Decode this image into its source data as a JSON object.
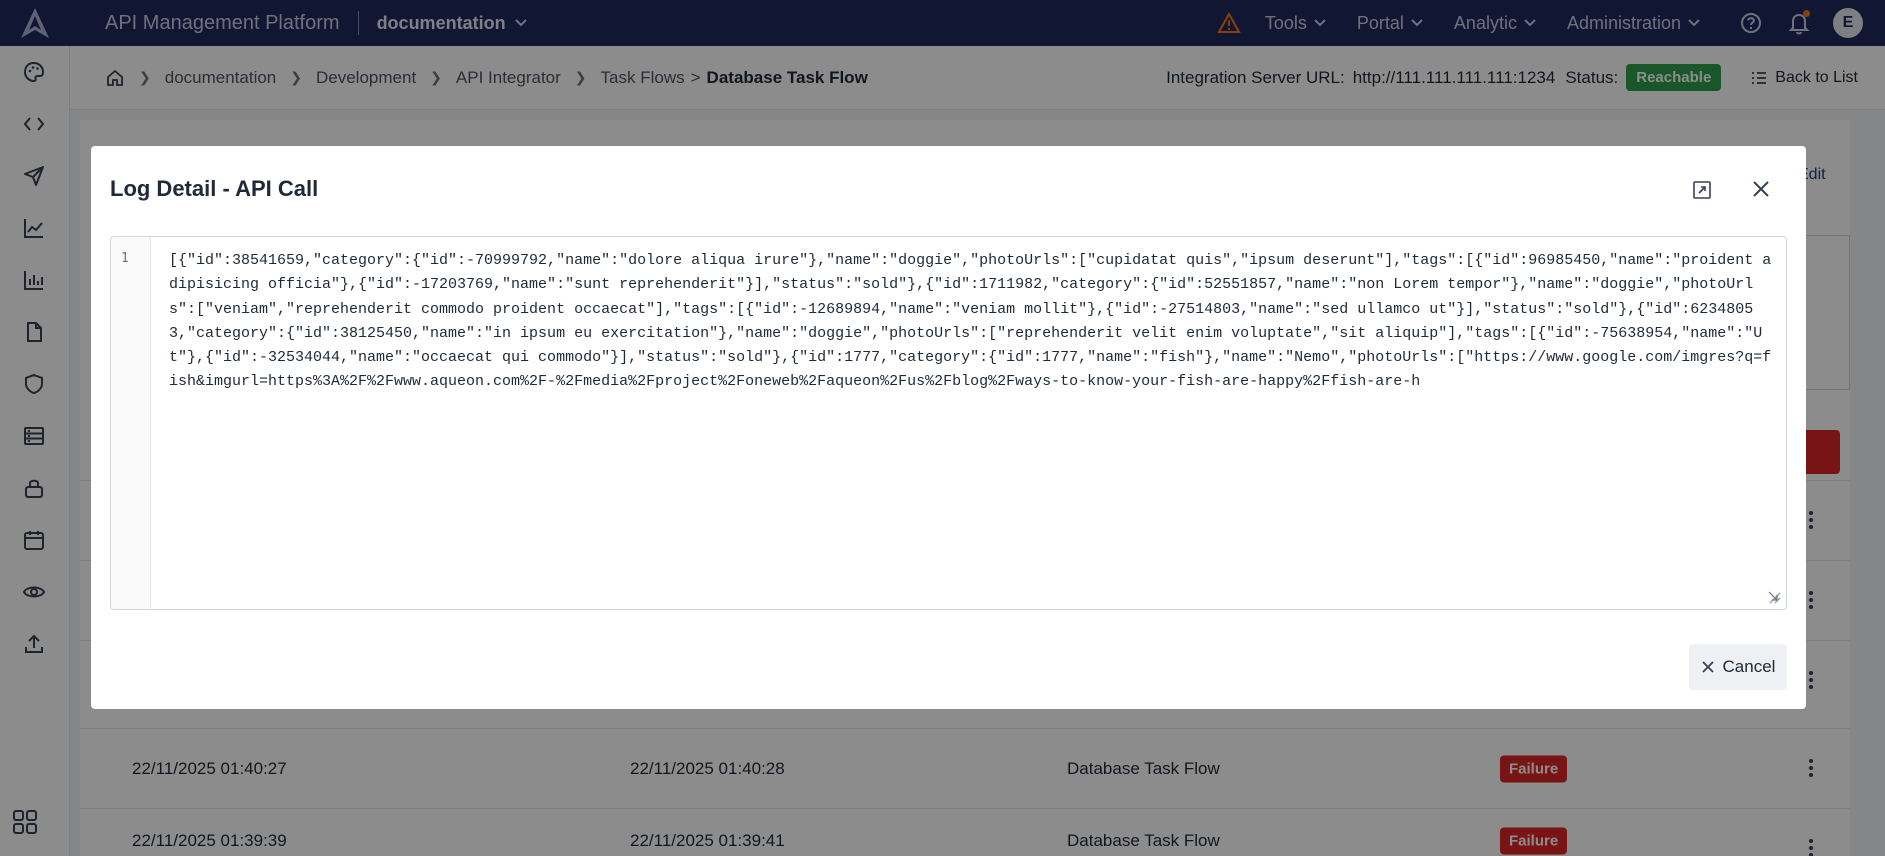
{
  "topbar": {
    "app_title": "API Management Platform",
    "workspace": "documentation",
    "nav": [
      "Tools",
      "Portal",
      "Analytic",
      "Administration"
    ],
    "avatar_initial": "E"
  },
  "breadcrumb": {
    "items": [
      "documentation",
      "Development",
      "API Integrator"
    ],
    "tail_link": "Task Flows",
    "tail_sep": ">",
    "current": "Database Task Flow"
  },
  "server": {
    "label": "Integration Server URL:",
    "url": "http://111.111.111.111:1234",
    "status_label": "Status:",
    "status_value": "Reachable",
    "back_label": "Back to List"
  },
  "content": {
    "edit_label": "Edit",
    "rows": [
      {
        "start": "22/11/2025 01:40:27",
        "end": "22/11/2025 01:40:28",
        "flow": "Database Task Flow",
        "status": "Failure"
      },
      {
        "start": "22/11/2025 01:39:39",
        "end": "22/11/2025 01:39:41",
        "flow": "Database Task Flow",
        "status": "Failure"
      }
    ]
  },
  "modal": {
    "title": "Log Detail - API Call",
    "line_number": "1",
    "code": "[{\"id\":38541659,\"category\":{\"id\":-70999792,\"name\":\"dolore aliqua irure\"},\"name\":\"doggie\",\"photoUrls\":[\"cupidatat quis\",\"ipsum deserunt\"],\"tags\":[{\"id\":96985450,\"name\":\"proident adipisicing officia\"},{\"id\":-17203769,\"name\":\"sunt reprehenderit\"}],\"status\":\"sold\"},{\"id\":1711982,\"category\":{\"id\":52551857,\"name\":\"non Lorem tempor\"},\"name\":\"doggie\",\"photoUrls\":[\"veniam\",\"reprehenderit commodo proident occaecat\"],\"tags\":[{\"id\":-12689894,\"name\":\"veniam mollit\"},{\"id\":-27514803,\"name\":\"sed ullamco ut\"}],\"status\":\"sold\"},{\"id\":62348053,\"category\":{\"id\":38125450,\"name\":\"in ipsum eu exercitation\"},\"name\":\"doggie\",\"photoUrls\":[\"reprehenderit velit enim voluptate\",\"sit aliquip\"],\"tags\":[{\"id\":-75638954,\"name\":\"Ut\"},{\"id\":-32534044,\"name\":\"occaecat qui commodo\"}],\"status\":\"sold\"},{\"id\":1777,\"category\":{\"id\":1777,\"name\":\"fish\"},\"name\":\"Nemo\",\"photoUrls\":[\"https://www.google.com/imgres?q=fish&imgurl=https%3A%2F%2Fwww.aqueon.com%2F-%2Fmedia%2Fproject%2Foneweb%2Faqueon%2Fus%2Fblog%2Fways-to-know-your-fish-are-happy%2Ffish-are-h",
    "cancel_label": "Cancel"
  }
}
